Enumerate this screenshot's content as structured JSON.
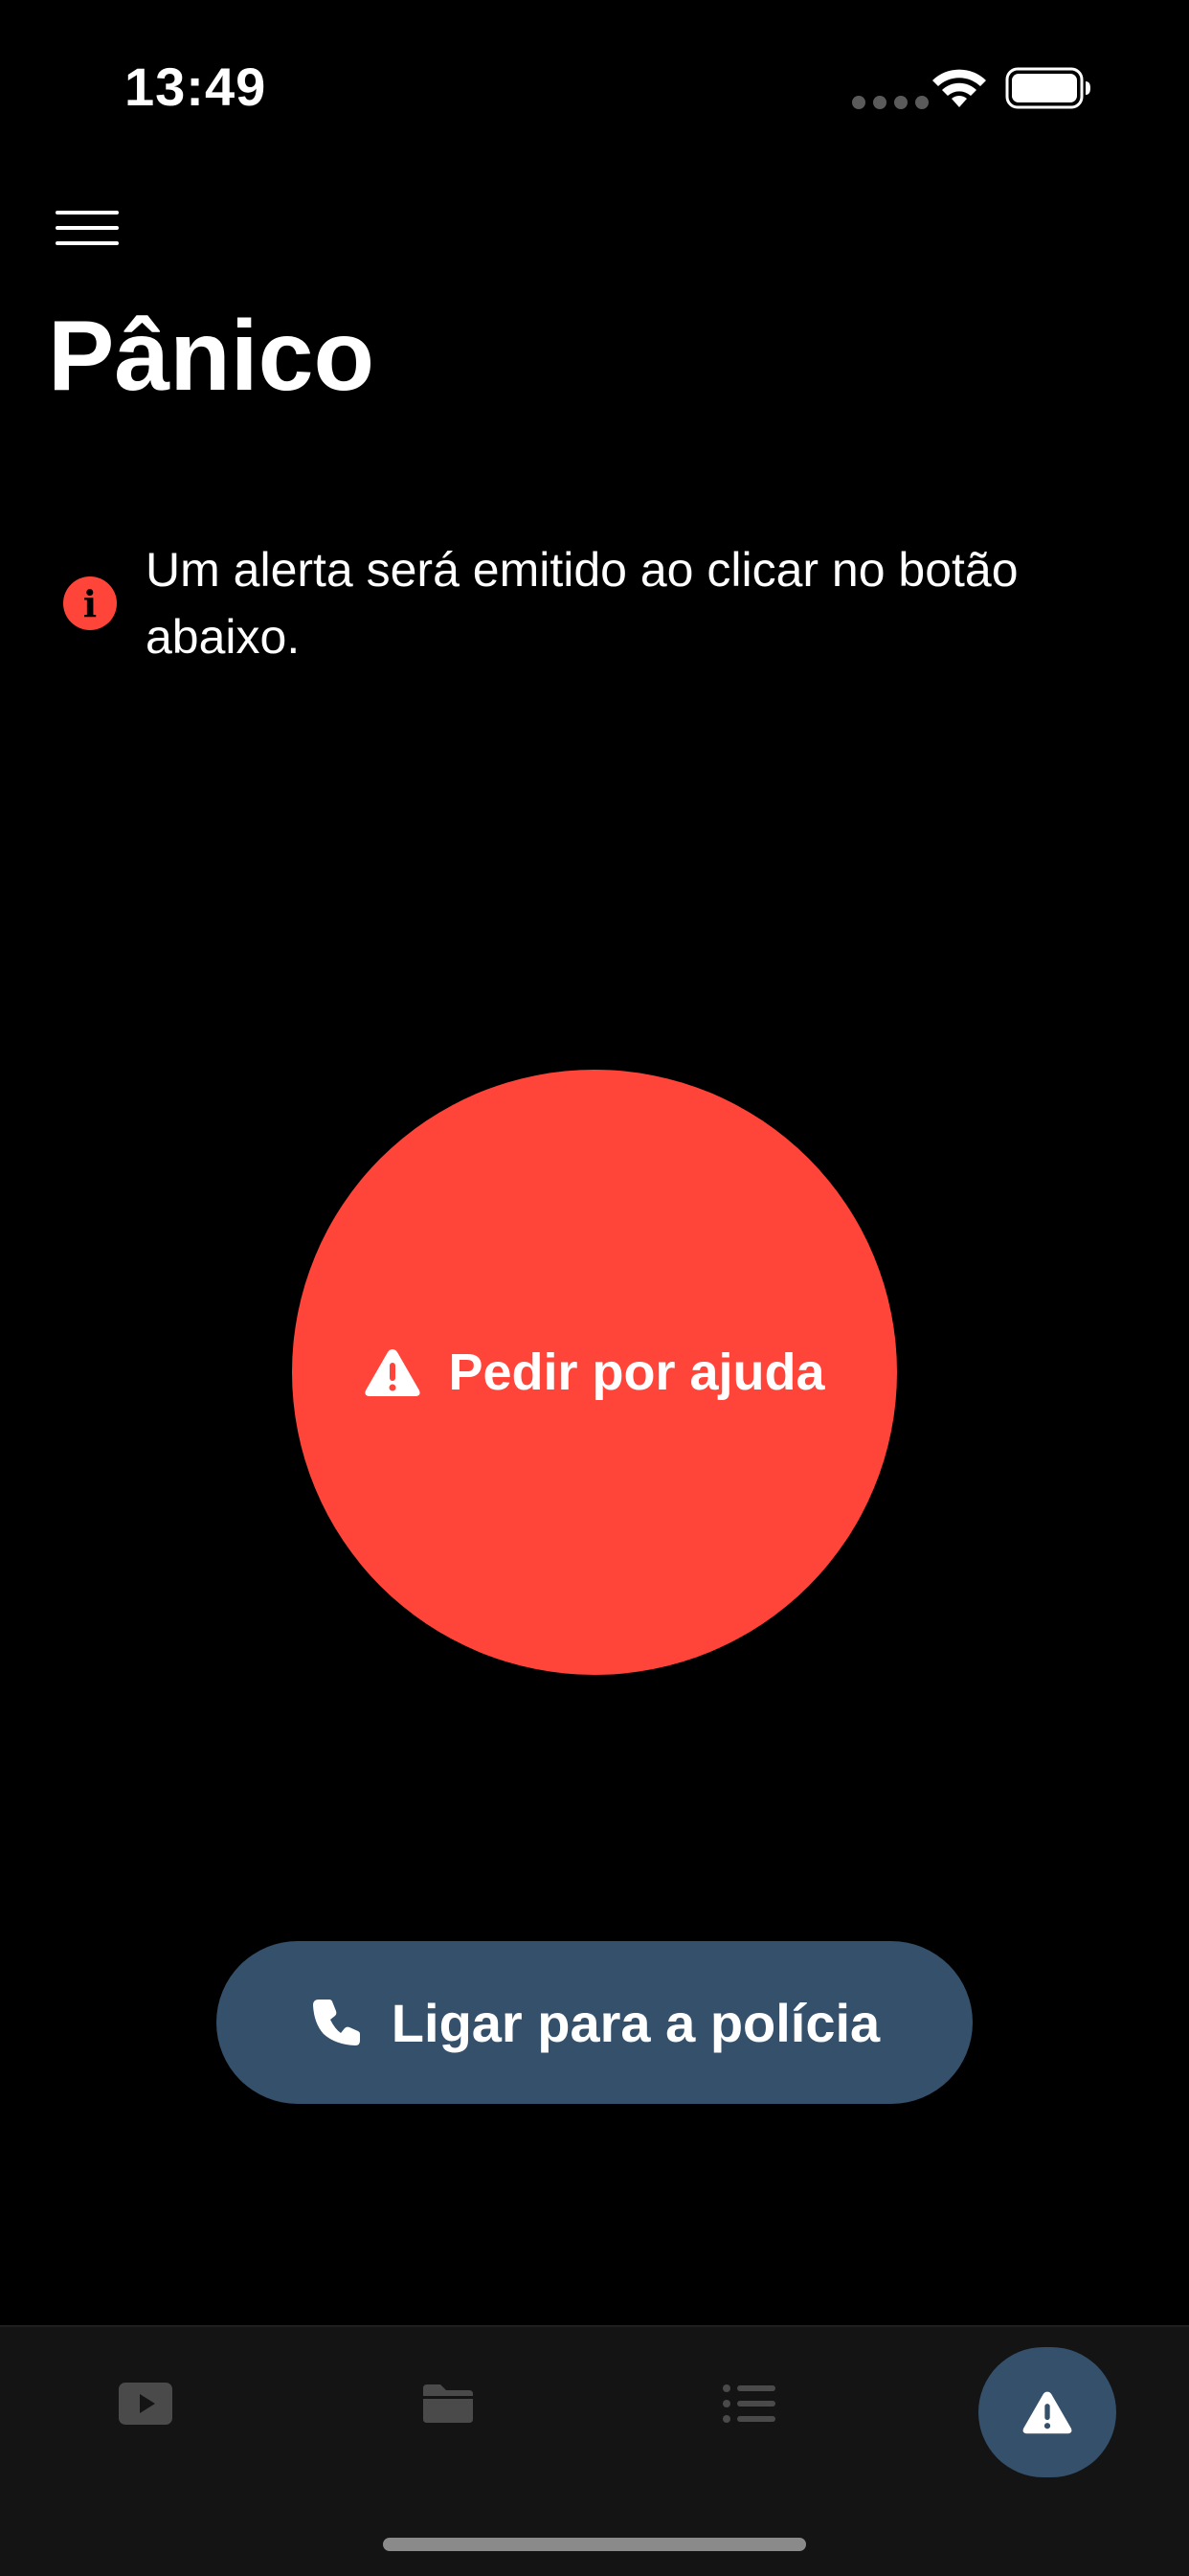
{
  "status_bar": {
    "time": "13:49"
  },
  "header": {
    "title": "Pânico"
  },
  "info": {
    "icon_glyph": "i",
    "message": "Um alerta será emitido ao clicar no botão abaixo."
  },
  "panic_button": {
    "label": "Pedir por ajuda",
    "color": "#ff453a"
  },
  "police_button": {
    "label": "Ligar para a polícia",
    "color": "#34506b"
  },
  "tab_bar": {
    "tabs": [
      {
        "icon": "play-icon",
        "active": false
      },
      {
        "icon": "folder-icon",
        "active": false
      },
      {
        "icon": "list-icon",
        "active": false
      },
      {
        "icon": "warning-icon",
        "active": true
      }
    ],
    "active_color": "#34506b"
  },
  "colors": {
    "background": "#000000",
    "accent_red": "#ff453a",
    "accent_blue": "#34506b",
    "tab_bar_bg": "#141414"
  }
}
